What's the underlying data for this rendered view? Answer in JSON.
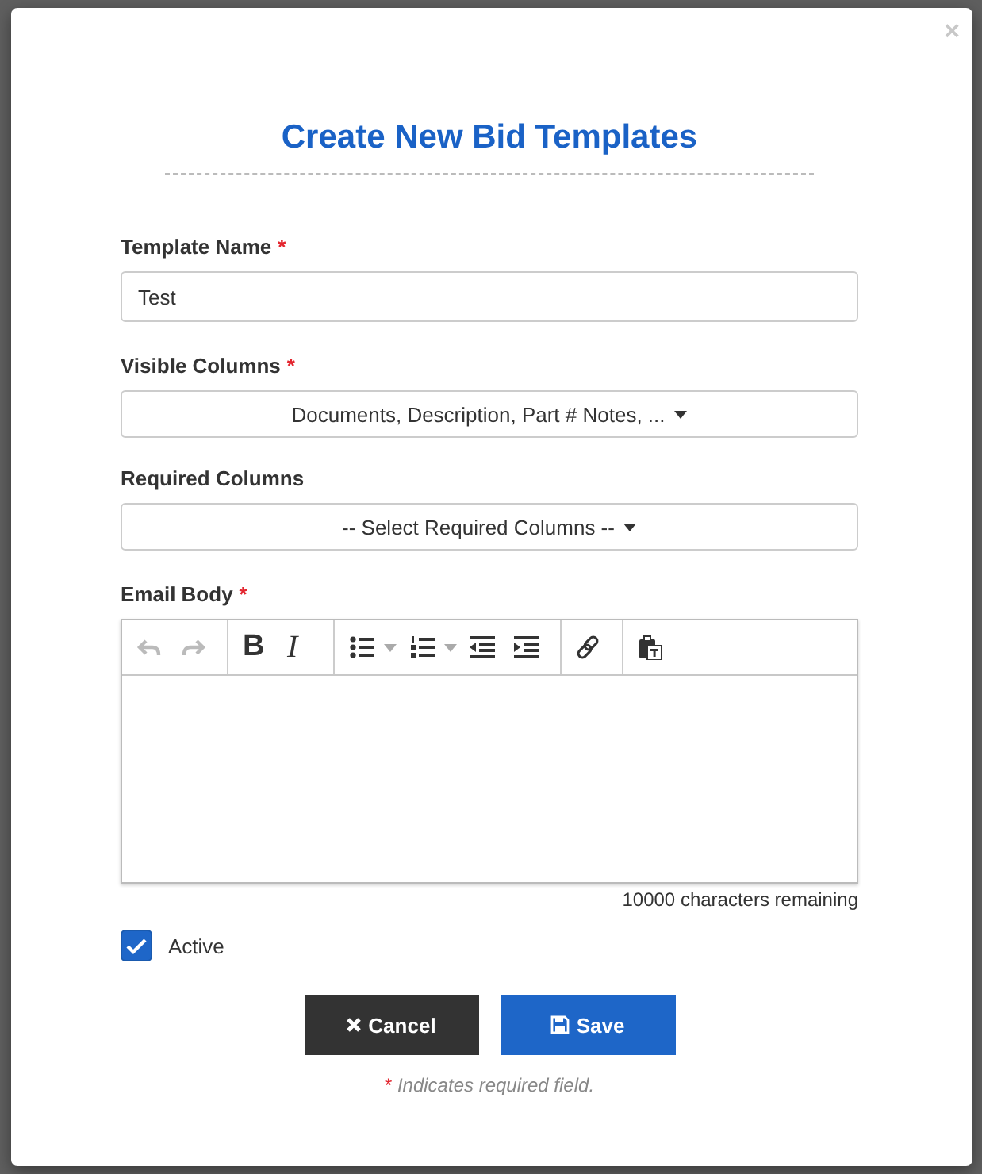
{
  "dialog": {
    "title": "Create New Bid Templates",
    "close": "×",
    "required_mark": "*"
  },
  "fields": [
    {
      "kind": "text",
      "label": "Template Name",
      "required": true,
      "value": "Test"
    },
    {
      "kind": "select",
      "label": "Visible Columns",
      "required": true,
      "value": "Documents, Description, Part # Notes, ..."
    },
    {
      "kind": "select",
      "label": "Required Columns",
      "required": false,
      "value": "-- Select Required Columns --"
    },
    {
      "kind": "editor",
      "label": "Email Body",
      "required": true,
      "counter": "10000 characters remaining",
      "toolbar": [
        [
          {
            "kind": "undo",
            "disabled": true,
            "dropdown": false
          },
          {
            "kind": "redo",
            "disabled": true,
            "dropdown": false
          }
        ],
        [
          {
            "kind": "bold",
            "text": "B",
            "disabled": false,
            "dropdown": false
          },
          {
            "kind": "italic",
            "text": "I",
            "disabled": false,
            "dropdown": false
          }
        ],
        [
          {
            "kind": "bullets",
            "disabled": false,
            "dropdown": true
          },
          {
            "kind": "numbers",
            "disabled": false,
            "dropdown": true
          },
          {
            "kind": "outdent",
            "disabled": false,
            "dropdown": false
          },
          {
            "kind": "indent",
            "disabled": false,
            "dropdown": false
          }
        ],
        [
          {
            "kind": "link",
            "disabled": false,
            "dropdown": false
          }
        ],
        [
          {
            "kind": "paste",
            "disabled": false,
            "dropdown": false
          }
        ]
      ]
    }
  ],
  "active": {
    "label": "Active",
    "checked": true
  },
  "buttons": [
    {
      "kind": "cancel",
      "label": "Cancel"
    },
    {
      "kind": "save",
      "label": "Save"
    }
  ],
  "footnote": {
    "mark": "*",
    "text": "Indicates required field."
  }
}
